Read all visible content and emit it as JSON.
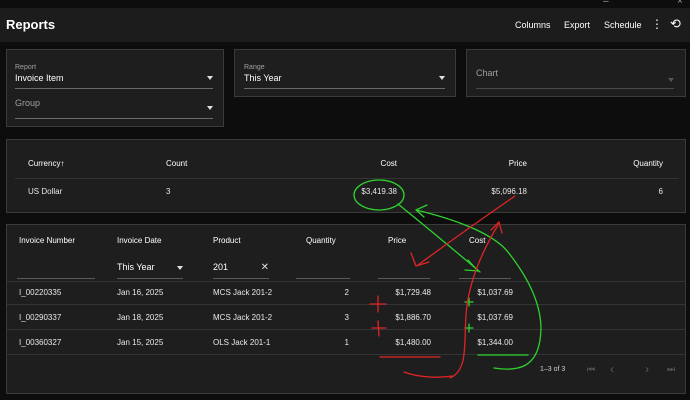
{
  "window": {
    "minimize": "–",
    "close": "×"
  },
  "appbar": {
    "title": "Reports",
    "columns_label": "Columns",
    "export_label": "Export",
    "schedule_label": "Schedule",
    "more_icon": "⋮",
    "history_icon": "⟲"
  },
  "filters": {
    "report": {
      "label": "Report",
      "value": "Invoice Item"
    },
    "group": {
      "label": "Group",
      "value": ""
    },
    "range": {
      "label": "Range",
      "value": "This Year"
    },
    "chart": {
      "label": "Chart",
      "value": ""
    }
  },
  "summary": {
    "headers": {
      "currency": "Currency",
      "sort_arrow": "↑",
      "count": "Count",
      "cost": "Cost",
      "price": "Price",
      "quantity": "Quantity"
    },
    "row": {
      "currency": "US Dollar",
      "count": "3",
      "cost": "$3,419.38",
      "price": "$5,096.18",
      "quantity": "6"
    }
  },
  "detail": {
    "headers": {
      "invoice_number": "Invoice Number",
      "invoice_date": "Invoice Date",
      "product": "Product",
      "quantity": "Quantity",
      "price": "Price",
      "cost": "Cost"
    },
    "filters": {
      "invoice_date": "This Year",
      "product": "201",
      "clear_icon": "✕"
    },
    "rows": [
      {
        "invoice_number": "I_00220335",
        "invoice_date": "Jan 16, 2025",
        "product": "MCS Jack 201-2",
        "quantity": "2",
        "price": "$1,729.48",
        "cost": "$1,037.69"
      },
      {
        "invoice_number": "I_00290337",
        "invoice_date": "Jan 18, 2025",
        "product": "MCS Jack 201-2",
        "quantity": "3",
        "price": "$1,886.70",
        "cost": "$1,037.69"
      },
      {
        "invoice_number": "I_00360327",
        "invoice_date": "Jan 15, 2025",
        "product": "OLS Jack 201-1",
        "quantity": "1",
        "price": "$1,480.00",
        "cost": "$1,344.00"
      }
    ],
    "pagination": {
      "range": "1–3 of 3",
      "first_icon": "⏮",
      "prev_icon": "‹",
      "next_icon": "›",
      "last_icon": "⏭"
    }
  },
  "colors": {
    "background": "#0d0d0d",
    "card": "#1e1e1e",
    "annotation_green": "#2fd12f",
    "annotation_red": "#e02424"
  }
}
